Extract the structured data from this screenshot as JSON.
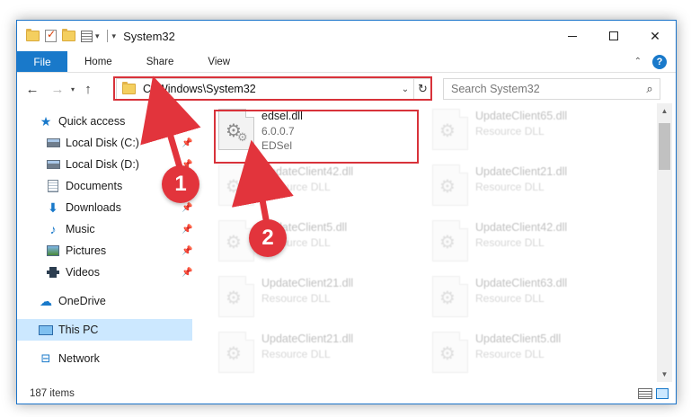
{
  "window": {
    "title": "System32",
    "controls": {
      "minimize": "–",
      "maximize": "□",
      "close": "✕"
    }
  },
  "ribbon": {
    "tabs": [
      "File",
      "Home",
      "Share",
      "View"
    ],
    "collapse_icon": "chevron-up-icon",
    "help_label": "?"
  },
  "navigation": {
    "back_icon": "←",
    "forward_icon": "→",
    "recent_icon": "▾",
    "up_icon": "↑",
    "address": "C:\\Windows\\System32",
    "refresh_icon": "↻",
    "search_placeholder": "Search System32",
    "search_icon": "⚲"
  },
  "sidebar": {
    "items": [
      {
        "label": "Quick access",
        "icon": "star-icon",
        "pinned": false
      },
      {
        "label": "Local Disk (C:)",
        "icon": "disk-icon",
        "pinned": true
      },
      {
        "label": "Local Disk (D:)",
        "icon": "disk-icon",
        "pinned": true
      },
      {
        "label": "Documents",
        "icon": "documents-icon",
        "pinned": true
      },
      {
        "label": "Downloads",
        "icon": "downloads-icon",
        "pinned": true
      },
      {
        "label": "Music",
        "icon": "music-icon",
        "pinned": true
      },
      {
        "label": "Pictures",
        "icon": "pictures-icon",
        "pinned": true
      },
      {
        "label": "Videos",
        "icon": "videos-icon",
        "pinned": true
      },
      {
        "label": "OneDrive",
        "icon": "onedrive-icon",
        "pinned": false
      },
      {
        "label": "This PC",
        "icon": "this-pc-icon",
        "pinned": false,
        "selected": true
      },
      {
        "label": "Network",
        "icon": "network-icon",
        "pinned": false
      }
    ]
  },
  "files": {
    "highlighted": {
      "name": "edsel.dll",
      "version": "6.0.0.7",
      "description": "EDSel"
    },
    "left_column": [
      {
        "name": "UpdateClient42.dll",
        "type": "Resource DLL"
      },
      {
        "name": "UpdateClient5.dll",
        "type": "Resource DLL"
      },
      {
        "name": "UpdateClient21.dll",
        "type": "Resource DLL"
      },
      {
        "name": "UpdateClient21.dll",
        "type": "Resource DLL"
      }
    ],
    "right_column": [
      {
        "name": "UpdateClient65.dll",
        "type": "Resource DLL"
      },
      {
        "name": "UpdateClient21.dll",
        "type": "Resource DLL"
      },
      {
        "name": "UpdateClient42.dll",
        "type": "Resource DLL"
      },
      {
        "name": "UpdateClient63.dll",
        "type": "Resource DLL"
      },
      {
        "name": "UpdateClient5.dll",
        "type": "Resource DLL"
      }
    ]
  },
  "status": {
    "item_count": "187 items"
  },
  "annotations": {
    "badge1": "1",
    "badge2": "2",
    "color": "#e2343c"
  }
}
